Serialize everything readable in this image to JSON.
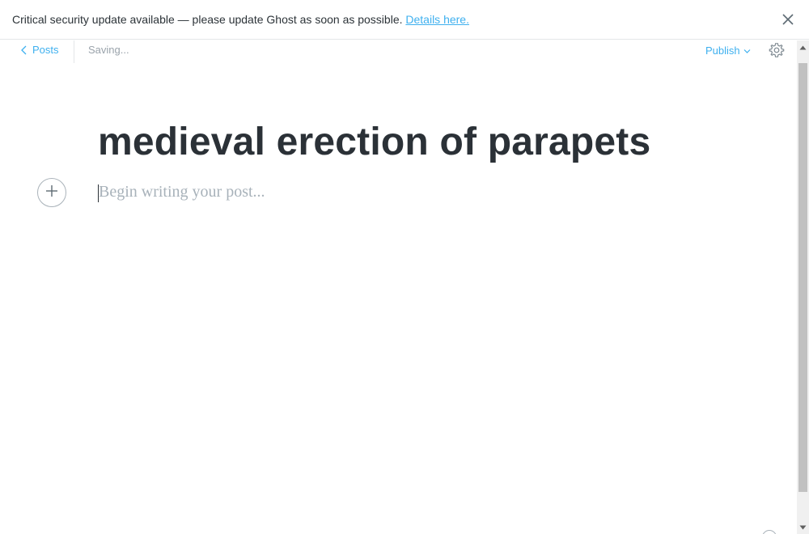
{
  "banner": {
    "message": "Critical security update available — please update Ghost as soon as possible.",
    "link_label": "Details here.",
    "close_icon": "close-icon"
  },
  "header": {
    "back_label": "Posts",
    "back_icon": "chevron-left-icon",
    "status": "Saving...",
    "publish_label": "Publish",
    "publish_icon": "chevron-down-icon",
    "settings_icon": "gear-icon"
  },
  "editor": {
    "title": "medieval erection of parapets",
    "body_placeholder": "Begin writing your post...",
    "add_card_icon": "plus-icon"
  },
  "colors": {
    "accent": "#3eb0ef",
    "text": "#2b3137",
    "muted": "#9aa3ab"
  }
}
